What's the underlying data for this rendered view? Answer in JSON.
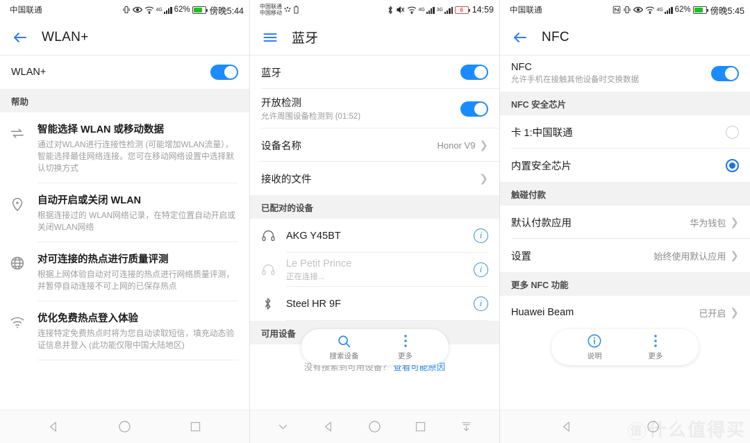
{
  "theme": {
    "accent": "#1a8cff",
    "link": "#2d8cf5",
    "group_bg": "#f2f2f2",
    "battery_green": "#20c020"
  },
  "watermark": {
    "mark": "值",
    "text": "什么值得买"
  },
  "screens": [
    {
      "id": "wlan-plus",
      "statusbar": {
        "carrier": "中国联通",
        "icons": [
          "vibrate-icon",
          "eye-icon",
          "wifi-icon",
          "signal-icon"
        ],
        "net_label": "4G",
        "battery_text": "62%",
        "time": "傍晚5:44"
      },
      "appbar": {
        "nav_icon": "back-arrow-icon",
        "title": "WLAN+"
      },
      "main_row": {
        "label": "WLAN+",
        "switch_on": true
      },
      "group_title": "帮助",
      "help_items": [
        {
          "icon": "swap-arrows-icon",
          "title": "智能选择 WLAN 或移动数据",
          "desc": "通过对WLAN进行连接性检测 (可能增加WLAN流量），智能选择最佳网络连接。您可在移动网络设置中选择默认切换方式"
        },
        {
          "icon": "location-pin-icon",
          "title": "自动开启或关闭 WLAN",
          "desc": "根据连接过的 WLAN网络记录，在特定位置自动开启或关闭WLAN网络"
        },
        {
          "icon": "globe-icon",
          "title": "对可连接的热点进行质量评测",
          "desc": "根据上网体验自动对可连接的热点进行网络质量评测，并暂停自动连接不可上网的已保存热点"
        },
        {
          "icon": "wifi-signal-icon",
          "title": "优化免费热点登入体验",
          "desc": "连接特定免费热点时将为您自动读取短信，填充动态验证信息并登入 (此功能仅限中国大陆地区)"
        }
      ],
      "navbar": [
        "back-triangle-icon",
        "home-circle-icon",
        "recents-square-icon"
      ]
    },
    {
      "id": "bluetooth",
      "statusbar": {
        "carrier_line1": "中国联通",
        "carrier_line2": "中国移动",
        "icons": [
          "bluetooth-icon",
          "mute-icon",
          "wifi-icon",
          "signal-icon",
          "signal-icon"
        ],
        "net_label_1": "4G",
        "net_label_2": "3G",
        "battery_text": "6",
        "time": "14:59"
      },
      "appbar": {
        "nav_icon": "hamburger-menu-icon",
        "title": "蓝牙"
      },
      "rows": [
        {
          "label": "蓝牙",
          "type": "switch",
          "switch_on": true
        },
        {
          "label": "开放检测",
          "sub": "允许周围设备检测到 (01:52)",
          "type": "switch",
          "switch_on": true
        },
        {
          "label": "设备名称",
          "value": "Honor V9",
          "type": "chevron"
        },
        {
          "label": "接收的文件",
          "value": "",
          "type": "chevron"
        }
      ],
      "paired_title": "已配对的设备",
      "paired_devices": [
        {
          "icon": "headphones-icon",
          "name": "AKG Y45BT",
          "sub": "",
          "dim": false
        },
        {
          "icon": "headphones-icon",
          "name": "Le Petit Prince",
          "sub": "正在连接...",
          "dim": true
        },
        {
          "icon": "bluetooth-icon",
          "name": "Steel HR 9F",
          "sub": "",
          "dim": false
        }
      ],
      "available_title": "可用设备",
      "empty_note": "没有搜索到可用设备？",
      "empty_link": "查看可能原因",
      "pill": [
        {
          "icon": "search-icon",
          "label": "搜索设备"
        },
        {
          "icon": "more-dots-icon",
          "label": "更多"
        }
      ],
      "navbar": [
        "chevron-down-icon",
        "back-triangle-icon",
        "home-circle-icon",
        "recents-square-icon",
        "pull-down-icon"
      ]
    },
    {
      "id": "nfc",
      "statusbar": {
        "carrier": "中国联通",
        "icons": [
          "nfc-icon",
          "vibrate-icon",
          "eye-icon",
          "wifi-icon",
          "signal-icon"
        ],
        "net_label": "4G",
        "battery_text": "62%",
        "time": "傍晚5:45"
      },
      "appbar": {
        "nav_icon": "back-arrow-icon",
        "title": "NFC"
      },
      "main_row": {
        "label": "NFC",
        "sub": "允许手机在接触其他设备时交换数据",
        "switch_on": true
      },
      "sections": [
        {
          "title": "NFC 安全芯片",
          "rows": [
            {
              "label": "卡 1:中国联通",
              "type": "radio",
              "selected": false
            },
            {
              "label": "内置安全芯片",
              "type": "radio",
              "selected": true
            }
          ]
        },
        {
          "title": "触碰付款",
          "rows": [
            {
              "label": "默认付款应用",
              "value": "华为钱包",
              "type": "chevron"
            },
            {
              "label": "设置",
              "value": "始终使用默认应用",
              "type": "chevron"
            }
          ]
        },
        {
          "title": "更多 NFC 功能",
          "rows": [
            {
              "label": "Huawei Beam",
              "value": "已开启",
              "type": "chevron"
            }
          ]
        }
      ],
      "pill": [
        {
          "icon": "info-icon",
          "label": "说明"
        },
        {
          "icon": "more-dots-icon",
          "label": "更多"
        }
      ],
      "navbar": [
        "back-triangle-icon",
        "home-circle-icon"
      ]
    }
  ]
}
